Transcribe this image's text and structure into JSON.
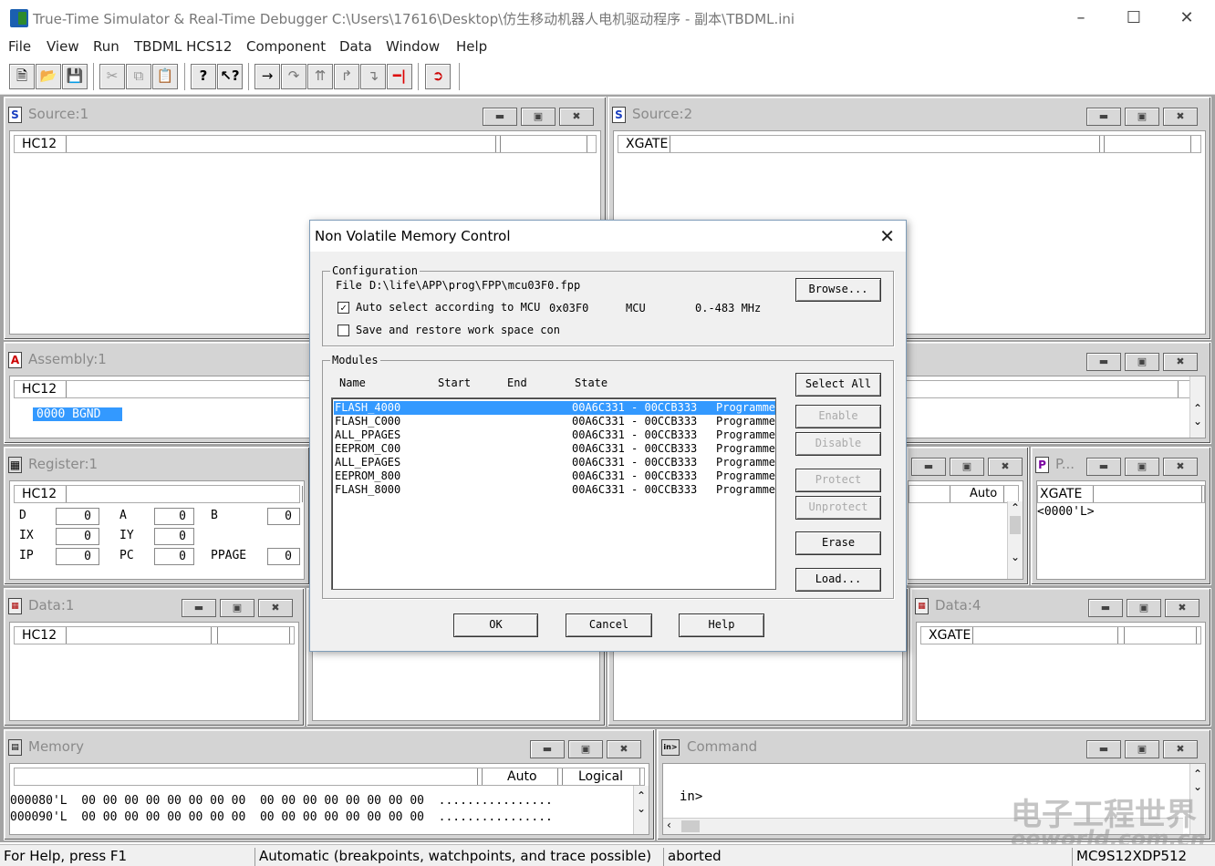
{
  "app": {
    "title": "True-Time Simulator & Real-Time Debugger   C:\\Users\\17616\\Desktop\\仿生移动机器人电机驱动程序 - 副本\\TBDML.ini"
  },
  "menu": [
    "File",
    "View",
    "Run",
    "TBDML HCS12",
    "Component",
    "Data",
    "Window",
    "Help"
  ],
  "toolbar": {
    "icons": [
      "new-icon",
      "open-icon",
      "save-icon",
      "cut-icon",
      "copy-icon",
      "paste-icon",
      "help-icon",
      "context-help-icon",
      "step-icon",
      "step-over-icon",
      "step-out-icon",
      "assembly-step-icon",
      "assembly-step-over-icon",
      "halt-icon",
      "reset-icon"
    ]
  },
  "windows": {
    "source1": {
      "title": "Source:1",
      "hdr": "HC12"
    },
    "source2": {
      "title": "Source:2",
      "hdr": "XGATE"
    },
    "assembly1": {
      "title": "Assembly:1",
      "hdr": "HC12",
      "line": "0000 BGND"
    },
    "register1": {
      "title": "Register:1",
      "hdr": "HC12",
      "regs": [
        {
          "n": "D",
          "v": "0"
        },
        {
          "n": "A",
          "v": "0"
        },
        {
          "n": "B",
          "v": "0"
        },
        {
          "n": "IX",
          "v": "0"
        },
        {
          "n": "IY",
          "v": "0"
        },
        {
          "n": "IP",
          "v": "0"
        },
        {
          "n": "PC",
          "v": "0"
        },
        {
          "n": "PPAGE",
          "v": "0"
        }
      ]
    },
    "procP": {
      "title": "P...",
      "hdr": "XGATE",
      "line": "<0000'L>"
    },
    "data1": {
      "title": "Data:1",
      "hdr": "HC12"
    },
    "data4": {
      "title": "Data:4",
      "hdr": "XGATE"
    },
    "memory": {
      "title": "Memory",
      "auto": "Auto",
      "logical": "Logical",
      "lines": [
        {
          "addr": "000080'L",
          "bytes1": "00 00 00 00 00 00 00 00",
          "bytes2": "00 00 00 00 00 00 00 00",
          "ascii": "................"
        },
        {
          "addr": "000090'L",
          "bytes1": "00 00 00 00 00 00 00 00",
          "bytes2": "00 00 00 00 00 00 00 00",
          "ascii": "................"
        }
      ]
    },
    "command": {
      "title": "Command",
      "prompt": "in>"
    },
    "data3": {
      "auto": "Auto"
    }
  },
  "dialog": {
    "title": "Non Volatile Memory Control",
    "config_label": "Configuration",
    "file_label": "File",
    "file_path": "D:\\life\\APP\\prog\\FPP\\mcu03F0.fpp",
    "browse": "Browse...",
    "auto_select": "Auto select according to MCU",
    "auto_select_checked": true,
    "mcu_code": "0x03F0",
    "mcu_label": "MCU",
    "freq": "0.-483 MHz",
    "save_restore": "Save and restore work space con",
    "save_restore_checked": false,
    "modules_label": "Modules",
    "columns": [
      "Name",
      "Start",
      "End",
      "State"
    ],
    "modules": [
      {
        "name": "FLASH_4000",
        "range": "00A6C331 - 00CCB333",
        "state": "Programme"
      },
      {
        "name": "FLASH_C000",
        "range": "00A6C331 - 00CCB333",
        "state": "Programme"
      },
      {
        "name": "ALL_PPAGES",
        "range": "00A6C331 - 00CCB333",
        "state": "Programme"
      },
      {
        "name": "EEPROM_C00",
        "range": "00A6C331 - 00CCB333",
        "state": "Programme"
      },
      {
        "name": "ALL_EPAGES",
        "range": "00A6C331 - 00CCB333",
        "state": "Programme"
      },
      {
        "name": "EEPROM_800",
        "range": "00A6C331 - 00CCB333",
        "state": "Programme"
      },
      {
        "name": "FLASH_8000",
        "range": "00A6C331 - 00CCB333",
        "state": "Programme"
      }
    ],
    "buttons": {
      "select_all": "Select All",
      "enable": "Enable",
      "disable": "Disable",
      "protect": "Protect",
      "unprotect": "Unprotect",
      "erase": "Erase",
      "load": "Load...",
      "ok": "OK",
      "cancel": "Cancel",
      "help": "Help"
    }
  },
  "status": {
    "help": "For Help, press F1",
    "mode": "Automatic (breakpoints, watchpoints, and trace possible)",
    "state": "aborted",
    "mcu": "MC9S12XDP512"
  },
  "watermark": {
    "cn": "电子工程世界",
    "en": "eeworld.com.cn"
  }
}
